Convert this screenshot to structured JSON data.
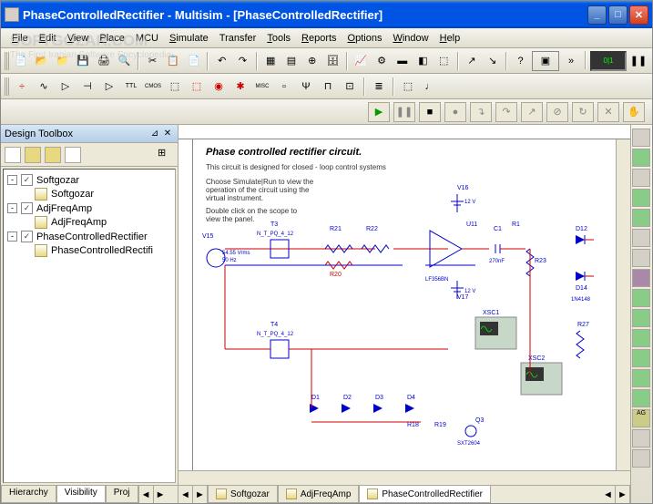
{
  "window": {
    "title": "PhaseControlledRectifier - Multisim - [PhaseControlledRectifier]"
  },
  "menu": {
    "file": "File",
    "edit": "Edit",
    "view": "View",
    "place": "Place",
    "mcu": "MCU",
    "simulate": "Simulate",
    "transfer": "Transfer",
    "tools": "Tools",
    "reports": "Reports",
    "options": "Options",
    "window": "Window",
    "help": "Help"
  },
  "sidebar": {
    "title": "Design Toolbox",
    "items": [
      {
        "label": "Softgozar",
        "child": "Softgozar"
      },
      {
        "label": "AdjFreqAmp",
        "child": "AdjFreqAmp"
      },
      {
        "label": "PhaseControlledRectifier",
        "child": "PhaseControlledRectifi"
      }
    ],
    "tabs": {
      "hierarchy": "Hierarchy",
      "visibility": "Visibility",
      "proj": "Proj"
    }
  },
  "schematic": {
    "title": "Phase controlled rectifier circuit.",
    "desc1": "This circuit is designed for closed - loop control systems",
    "desc2": "Choose Simulate|Run to view the",
    "desc3": "operation of the circuit using the",
    "desc4": "virtual instrument.",
    "desc5": "Double click on the scope to",
    "desc6": "view the panel.",
    "components": {
      "v15": "V15",
      "v15val": "54.55 Vrms",
      "v15freq": "50 Hz",
      "t3": "T3",
      "t3val": "N_T_PQ_4_12",
      "t4": "T4",
      "t4val": "N_T_PQ_4_12",
      "r20": "R20",
      "r21": "R21",
      "r22": "R22",
      "r23": "R23",
      "d1": "D1",
      "d2": "D2",
      "d3": "D3",
      "d4": "D4",
      "d12": "D12",
      "d14": "D14",
      "v16": "V16",
      "v16val": "12 V",
      "v17": "V17",
      "v17val": "12 V",
      "u11": "U11",
      "u11val": "LF356BN",
      "c1": "C1",
      "c1val": "270nF",
      "r1": "R1",
      "xsc1": "XSC1",
      "xsc2": "XSC2",
      "q3": "Q3",
      "q3val": "SXT2604",
      "r18": "R18",
      "r19": "R19",
      "in4148": "1N4148"
    }
  },
  "doc_tabs": {
    "t1": "Softgozar",
    "t2": "AdjFreqAmp",
    "t3": "PhaseControlledRectifier"
  },
  "watermark": {
    "line1": "SOFTGOZAR.COM",
    "line2": "The First Iranian Software Encyclopedia"
  }
}
